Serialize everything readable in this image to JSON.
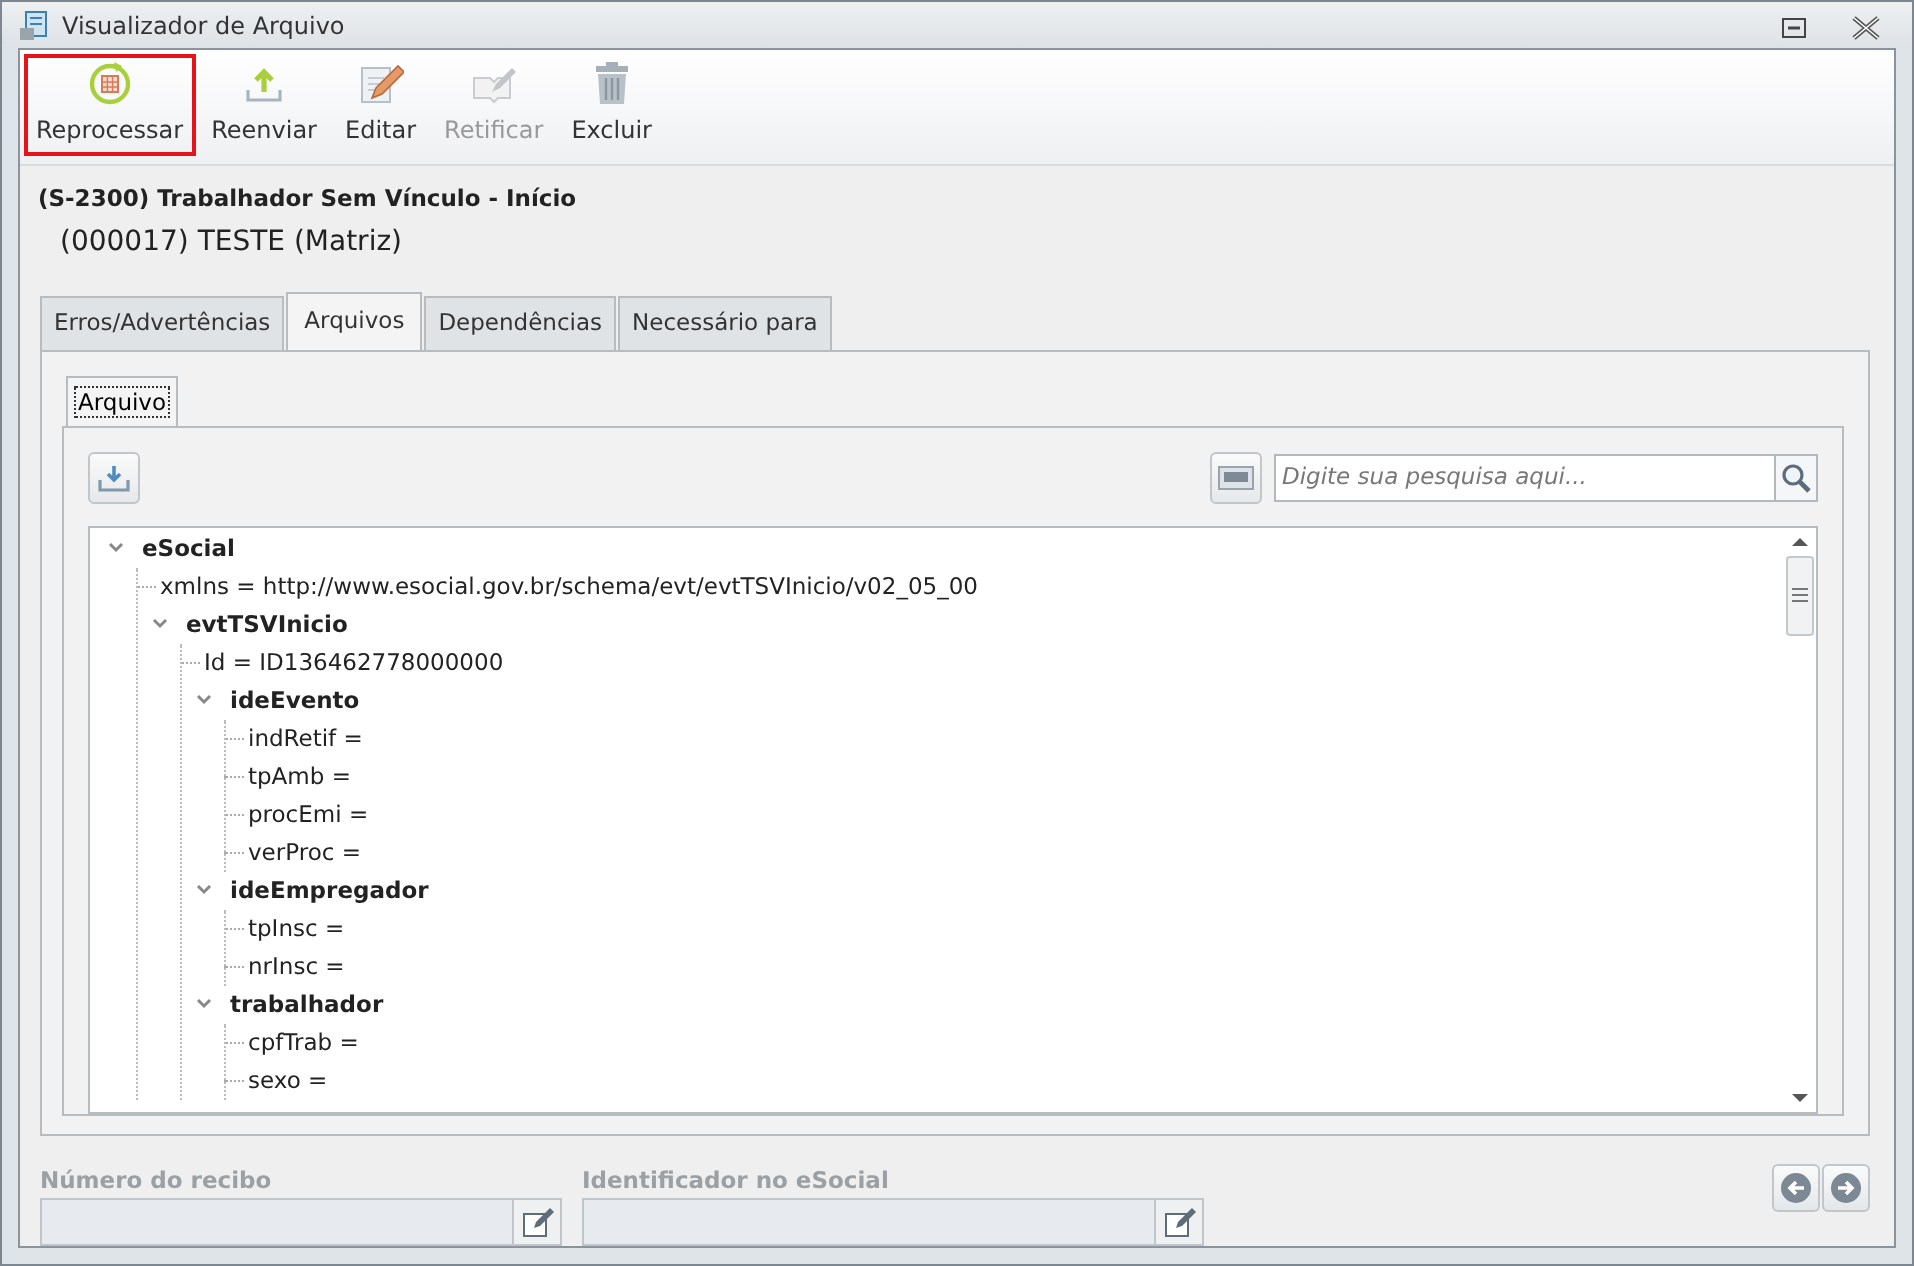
{
  "window": {
    "title": "Visualizador de Arquivo"
  },
  "toolbar": [
    {
      "kind": "reprocess",
      "label": "Reprocessar",
      "selected": true,
      "disabled": false
    },
    {
      "kind": "upload",
      "label": "Reenviar",
      "selected": false,
      "disabled": false
    },
    {
      "kind": "edit",
      "label": "Editar",
      "selected": false,
      "disabled": false
    },
    {
      "kind": "rectify",
      "label": "Retificar",
      "selected": false,
      "disabled": true
    },
    {
      "kind": "delete",
      "label": "Excluir",
      "selected": false,
      "disabled": false
    }
  ],
  "header": {
    "event": "(S-2300) Trabalhador Sem Vínculo - Início",
    "company": "(000017) TESTE (Matriz)"
  },
  "tabs": [
    {
      "label": "Erros/Advertências",
      "selected": false
    },
    {
      "label": "Arquivos",
      "selected": true
    },
    {
      "label": "Dependências",
      "selected": false
    },
    {
      "label": "Necessário para",
      "selected": false
    }
  ],
  "inner_tabs": [
    {
      "label": "Arquivo",
      "selected": true
    }
  ],
  "search": {
    "placeholder": "Digite sua pesquisa aqui..."
  },
  "tree": [
    {
      "kind": "element",
      "label": "eSocial",
      "expanded": true,
      "children": [
        {
          "kind": "attribute",
          "label": "xmlns = http://www.esocial.gov.br/schema/evt/evtTSVInicio/v02_05_00"
        },
        {
          "kind": "element",
          "label": "evtTSVInicio",
          "expanded": true,
          "children": [
            {
              "kind": "attribute",
              "label": "Id = ID136462778000000"
            },
            {
              "kind": "element",
              "label": "ideEvento",
              "expanded": true,
              "children": [
                {
                  "kind": "attribute",
                  "label": "indRetif ="
                },
                {
                  "kind": "attribute",
                  "label": "tpAmb ="
                },
                {
                  "kind": "attribute",
                  "label": "procEmi ="
                },
                {
                  "kind": "attribute",
                  "label": "verProc ="
                }
              ]
            },
            {
              "kind": "element",
              "label": "ideEmpregador",
              "expanded": true,
              "children": [
                {
                  "kind": "attribute",
                  "label": "tpInsc ="
                },
                {
                  "kind": "attribute",
                  "label": "nrInsc ="
                }
              ]
            },
            {
              "kind": "element",
              "label": "trabalhador",
              "expanded": true,
              "children": [
                {
                  "kind": "attribute",
                  "label": "cpfTrab ="
                },
                {
                  "kind": "attribute",
                  "label": "sexo ="
                }
              ]
            }
          ]
        }
      ]
    }
  ],
  "fields": [
    {
      "label": "Número do recibo",
      "disabled": true
    },
    {
      "label": "Identificador no eSocial",
      "disabled": true
    }
  ]
}
